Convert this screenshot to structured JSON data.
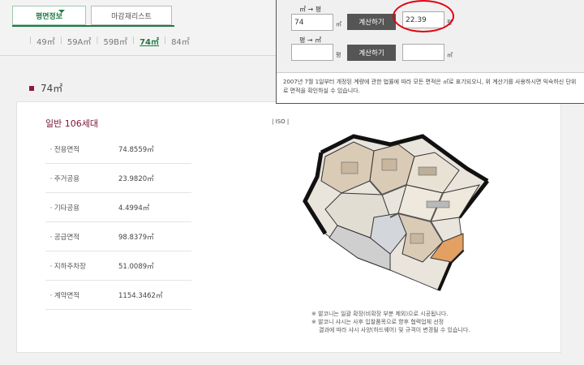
{
  "tabs": {
    "floor_plan": "평면정보",
    "finish_list": "마감재리스트"
  },
  "sizes": [
    {
      "label": "49㎡",
      "active": false
    },
    {
      "label": "59A㎡",
      "active": false
    },
    {
      "label": "59B㎡",
      "active": false
    },
    {
      "label": "74㎡",
      "active": true
    },
    {
      "label": "84㎡",
      "active": false
    }
  ],
  "heading": "74㎡",
  "unit_type": "일반 106세대",
  "areas": [
    {
      "label": "ㆍ전용면적",
      "value": "74.8559㎡"
    },
    {
      "label": "ㆍ주거공용",
      "value": "23.9820㎡"
    },
    {
      "label": "ㆍ기타공용",
      "value": "4.4994㎡"
    },
    {
      "label": "ㆍ공급면적",
      "value": "98.8379㎡"
    },
    {
      "label": "ㆍ지하주차장",
      "value": "51.0089㎡"
    },
    {
      "label": "ㆍ계약면적",
      "value": "1154.3462㎡"
    }
  ],
  "iso_label": "| ISO |",
  "notes": [
    "※ 발코니는 일괄 확장(비확장 부분 제외)으로 시공됩니다.",
    "※ 발코니 샤시는 사후 입찰품목으로 향후 협력업체 선정",
    "결과에 따라 샤시 사양(하드웨어) 및 규격이 변경될 수 있습니다."
  ],
  "calculator": {
    "row1_label": "㎡ → 평",
    "row1_input": "74",
    "row1_input_unit": "㎡",
    "row1_button": "계산하기",
    "row1_result": "22.39",
    "row1_result_unit": "평",
    "row2_label": "평 → ㎡",
    "row2_input": "",
    "row2_input_unit": "평",
    "row2_button": "계산하기",
    "row2_result": "",
    "row2_result_unit": "㎡",
    "note": "2007년 7월 1일부터 개정된 계량에 관한 법률에 따라 모든 면적은 ㎡로 표기되오니, 위 계산기를 사용하시면 익숙하신 단위로 면적을 확인하실 수 있습니다."
  },
  "colors": {
    "accent_green": "#1e7a45",
    "accent_burgundy": "#7a1433",
    "annotation_red": "#e2000f"
  }
}
